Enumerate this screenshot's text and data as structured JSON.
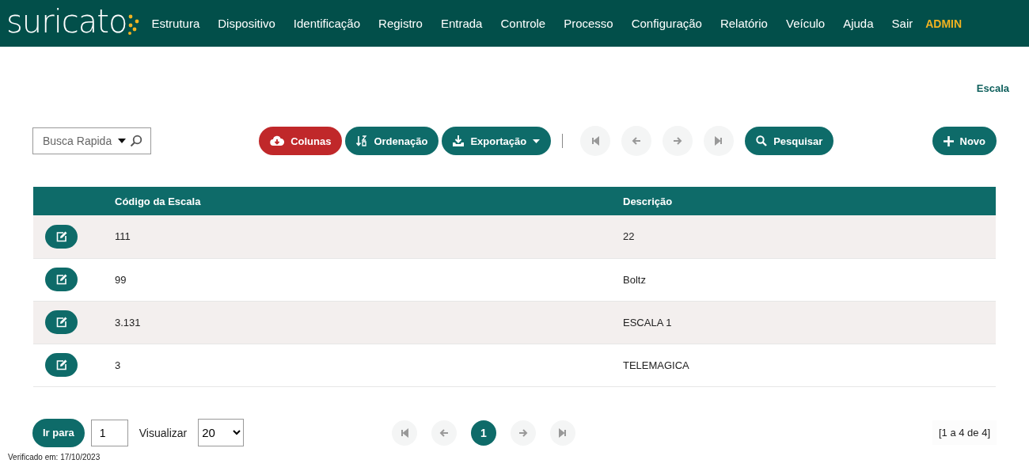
{
  "brand": {
    "name": "suricato"
  },
  "nav": [
    {
      "label": "Estrutura"
    },
    {
      "label": "Dispositivo"
    },
    {
      "label": "Identificação"
    },
    {
      "label": "Registro"
    },
    {
      "label": "Entrada"
    },
    {
      "label": "Controle"
    },
    {
      "label": "Processo"
    },
    {
      "label": "Configuração"
    },
    {
      "label": "Relatório"
    },
    {
      "label": "Veículo"
    },
    {
      "label": "Ajuda"
    },
    {
      "label": "Sair"
    }
  ],
  "user": "ADMIN",
  "page_title": "Escala",
  "quick_search": {
    "placeholder": "Busca Rapida"
  },
  "toolbar": [
    {
      "kind": "columns",
      "label": "Colunas"
    },
    {
      "kind": "sort",
      "label": "Ordenação"
    },
    {
      "kind": "export",
      "label": "Exportação"
    }
  ],
  "nav_buttons": [
    {
      "kind": "first",
      "disabled": true
    },
    {
      "kind": "prev",
      "disabled": true
    },
    {
      "kind": "next",
      "disabled": true
    },
    {
      "kind": "last",
      "disabled": true
    }
  ],
  "search_button": "Pesquisar",
  "new_button": "Novo",
  "table": {
    "columns": [
      "Código da Escala",
      "Descrição"
    ],
    "rows": [
      {
        "code": "111",
        "description": "22"
      },
      {
        "code": "99",
        "description": "Boltz"
      },
      {
        "code": "3.131",
        "description": "ESCALA 1"
      },
      {
        "code": "3",
        "description": "TELEMAGICA"
      }
    ]
  },
  "footer": {
    "goto_button": "Ir para",
    "goto_value": "1",
    "view_label": "Visualizar",
    "page_size": "20",
    "pager_nav": [
      {
        "kind": "first",
        "disabled": true
      },
      {
        "kind": "prev",
        "disabled": true
      },
      {
        "kind": "next",
        "disabled": true
      },
      {
        "kind": "last",
        "disabled": true
      }
    ],
    "pages": [
      {
        "label": "1",
        "selected": true
      }
    ],
    "range": "[1 a 4 de 4]",
    "verified": "Verificado em: 17/10/2023"
  }
}
